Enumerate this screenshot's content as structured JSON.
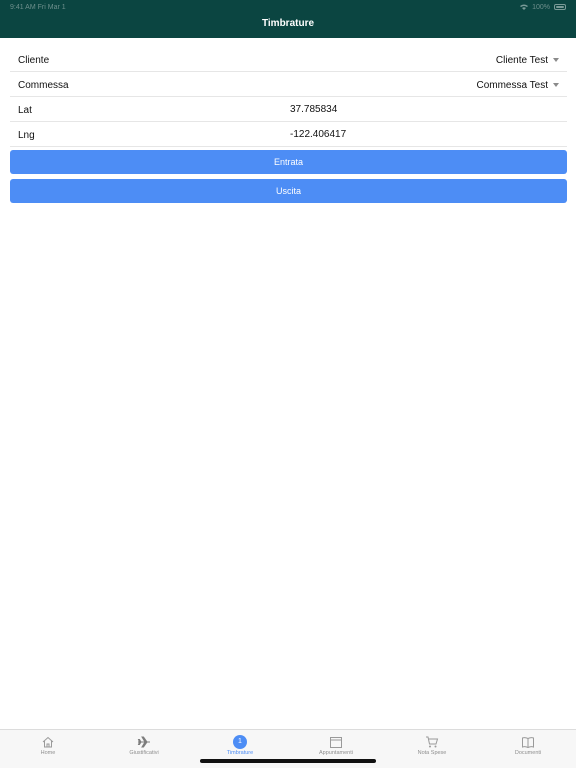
{
  "status_bar": {
    "time": "9:41 AM",
    "date": "Fri Mar 1",
    "battery": "100%"
  },
  "nav": {
    "title": "Timbrature"
  },
  "form": {
    "cliente": {
      "label": "Cliente",
      "value": "Cliente Test"
    },
    "commessa": {
      "label": "Commessa",
      "value": "Commessa Test"
    },
    "lat": {
      "label": "Lat",
      "value": "37.785834"
    },
    "lng": {
      "label": "Lng",
      "value": "-122.406417"
    }
  },
  "buttons": {
    "entrata": "Entrata",
    "uscita": "Uscita"
  },
  "tabs": [
    {
      "label": "Home",
      "icon": "home-icon"
    },
    {
      "label": "Giustificativi",
      "icon": "airplane-icon"
    },
    {
      "label": "Timbrature",
      "icon": "clock-badge-icon",
      "badge": "1",
      "active": true
    },
    {
      "label": "Appuntamenti",
      "icon": "calendar-icon"
    },
    {
      "label": "Nota Spese",
      "icon": "cart-icon"
    },
    {
      "label": "Documenti",
      "icon": "book-icon"
    }
  ],
  "colors": {
    "nav_bg": "#0b4541",
    "accent": "#4d8df5"
  }
}
